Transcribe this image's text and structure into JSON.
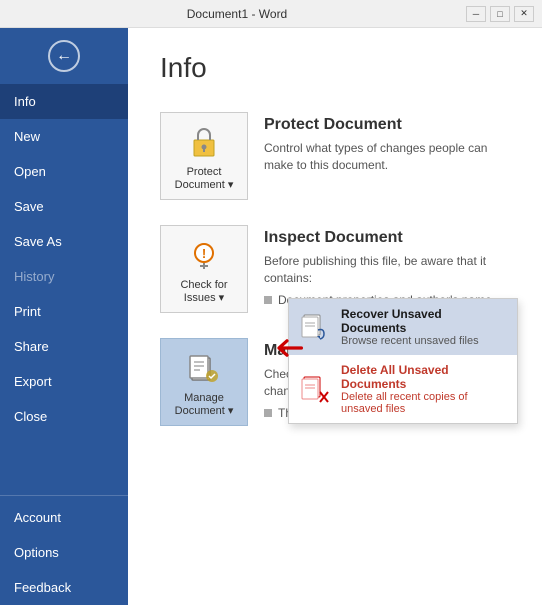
{
  "titleBar": {
    "text": "Document1 - Word"
  },
  "sidebar": {
    "back_label": "←",
    "items": [
      {
        "id": "info",
        "label": "Info",
        "active": true
      },
      {
        "id": "new",
        "label": "New"
      },
      {
        "id": "open",
        "label": "Open"
      },
      {
        "id": "save",
        "label": "Save"
      },
      {
        "id": "save-as",
        "label": "Save As"
      },
      {
        "id": "history",
        "label": "History",
        "disabled": true
      },
      {
        "id": "print",
        "label": "Print"
      },
      {
        "id": "share",
        "label": "Share"
      },
      {
        "id": "export",
        "label": "Export"
      },
      {
        "id": "close",
        "label": "Close"
      }
    ],
    "bottom_items": [
      {
        "id": "account",
        "label": "Account"
      },
      {
        "id": "options",
        "label": "Options"
      },
      {
        "id": "feedback",
        "label": "Feedback"
      }
    ]
  },
  "main": {
    "page_title": "Info",
    "sections": [
      {
        "id": "protect",
        "icon_label": "Protect\nDocument ▾",
        "title": "Protect Document",
        "desc": "Control what types of changes people can make to this document.",
        "sub_items": []
      },
      {
        "id": "inspect",
        "icon_label": "Check for\nIssues ▾",
        "title": "Inspect Document",
        "desc": "Before publishing this file, be aware that it contains:",
        "sub_items": [
          "Document properties and author's name"
        ]
      },
      {
        "id": "manage",
        "icon_label": "Manage\nDocument ▾",
        "title": "Manage Document",
        "desc": "Check out document or recover unsaved changes.",
        "sub_items": [
          "There are no unsaved changes."
        ],
        "active": true
      }
    ],
    "dropdown": {
      "items": [
        {
          "id": "recover",
          "title": "Recover Unsaved Documents",
          "desc": "Browse recent unsaved files",
          "highlighted": true
        },
        {
          "id": "delete",
          "title": "Delete All Unsaved Documents",
          "desc": "Delete all recent copies of unsaved files",
          "danger": true
        }
      ]
    }
  }
}
